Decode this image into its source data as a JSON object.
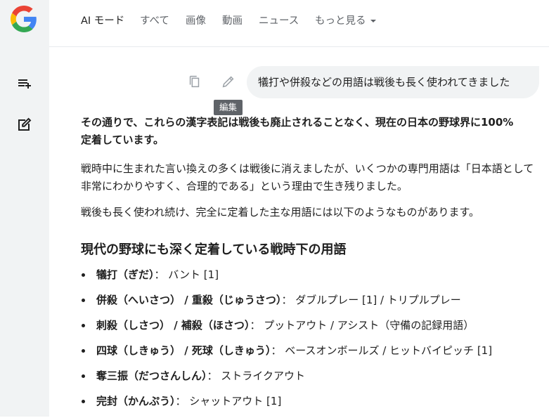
{
  "nav": {
    "tabs": [
      {
        "label": "AI モード"
      },
      {
        "label": "すべて"
      },
      {
        "label": "画像"
      },
      {
        "label": "動画"
      },
      {
        "label": "ニュース"
      },
      {
        "label": "もっと見る"
      }
    ]
  },
  "query": {
    "text": "犠打や併殺などの用語は戦後も長く使われてきました",
    "edit_tooltip": "編集"
  },
  "answer": {
    "lead": "その通りで、これらの漢字表記は戦後も廃止されることなく、現在の日本の野球界に100%定着しています。",
    "para1": "戦時中に生まれた言い換えの多くは戦後に消えましたが、いくつかの専門用語は「日本語として非常にわかりやすく、合理的である」という理由で生き残りました。",
    "para2": "戦後も長く使われ続け、完全に定着した主な用語には以下のようなものがあります。",
    "heading": "現代の野球にも深く定着している戦時下の用語",
    "items": [
      {
        "term": "犠打（ぎだ）",
        "desc": "： バント [1]"
      },
      {
        "term": "併殺（へいさつ） / 重殺（じゅうさつ）",
        "desc": "： ダブルプレー [1] / トリプルプレー"
      },
      {
        "term": "刺殺（しさつ） / 補殺（ほさつ）",
        "desc": "： プットアウト / アシスト（守備の記録用語）"
      },
      {
        "term": "四球（しきゅう） / 死球（しきゅう）",
        "desc": "： ベースオンボールズ / ヒットバイピッチ [1]"
      },
      {
        "term": "奪三振（だつさんしん）",
        "desc": "： ストライクアウト"
      },
      {
        "term": "完封（かんぷう）",
        "desc": "： シャットアウト [1]"
      }
    ]
  },
  "colors": {
    "sidebar_bg": "#f1f3f4",
    "bubble_bg": "#f1f3f4",
    "text": "#1f1f1f",
    "muted": "#5f6368"
  },
  "icons": {
    "logo": "google-g-logo",
    "sidebar_top": "new-playlist-icon",
    "sidebar_bottom": "new-chat-icon",
    "copy": "copy-icon",
    "edit": "pencil-icon"
  }
}
